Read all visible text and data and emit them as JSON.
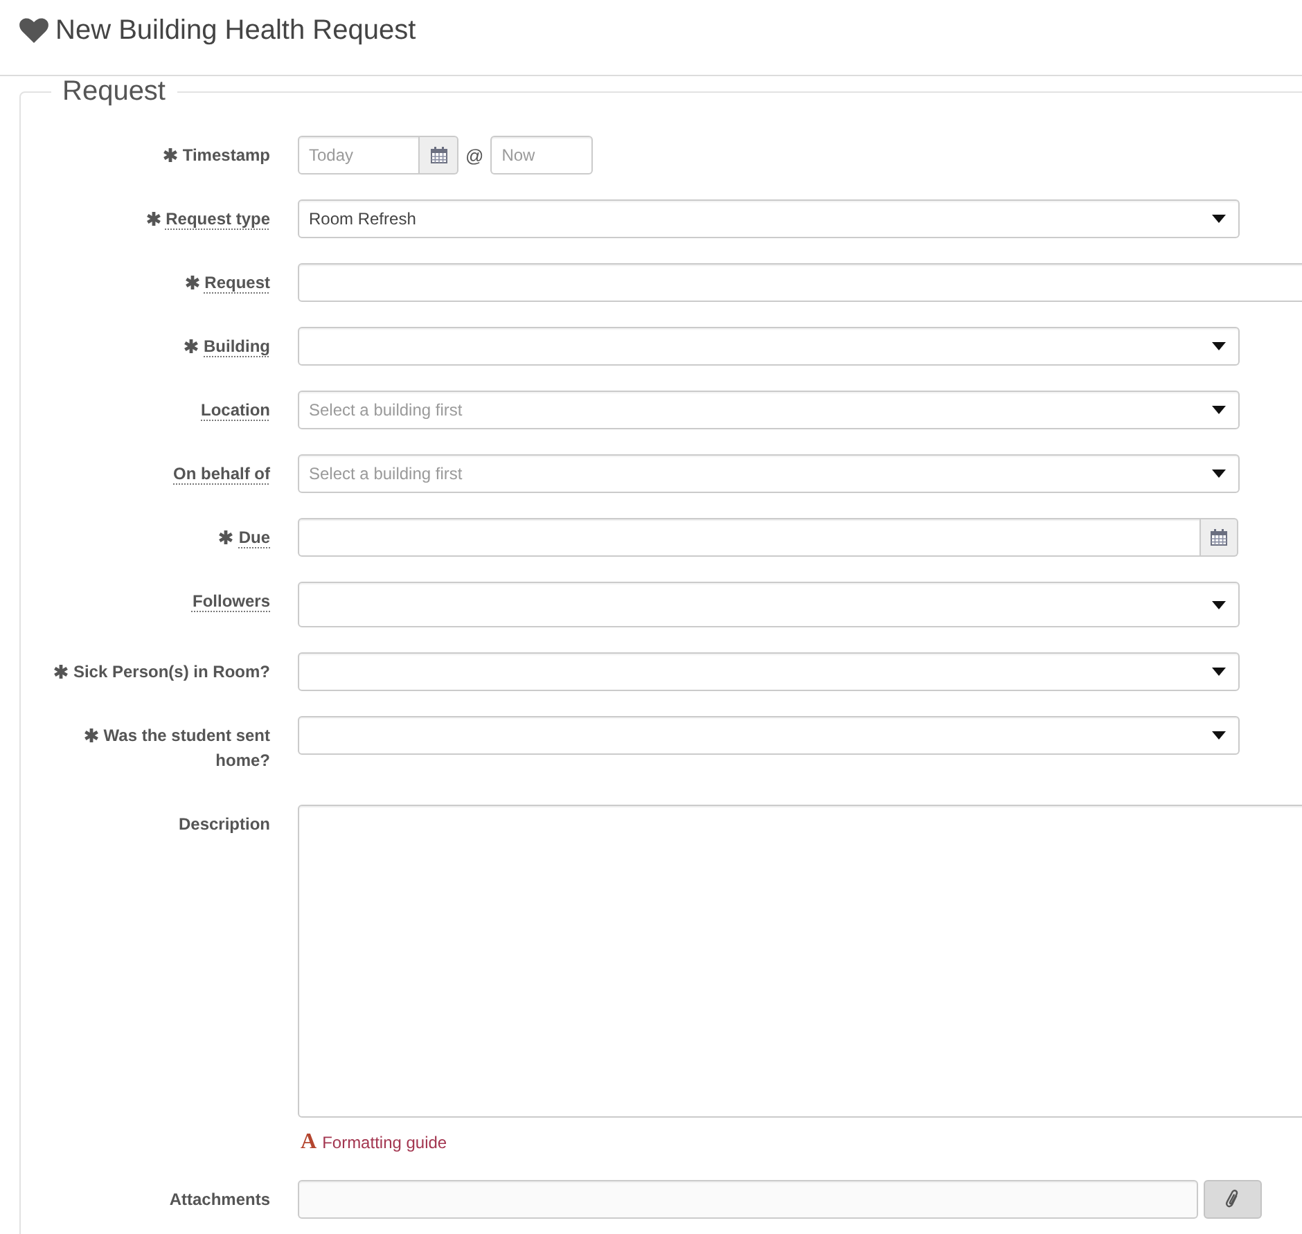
{
  "page": {
    "title": "New Building Health Request"
  },
  "fieldset": {
    "legend": "Request"
  },
  "fields": [
    {
      "kind": "datetime",
      "label": "Timestamp",
      "required": true,
      "tooltip": false,
      "date_placeholder": "Today",
      "separator": "@",
      "time_placeholder": "Now"
    },
    {
      "kind": "select",
      "label": "Request type",
      "required": true,
      "tooltip": true,
      "value": "Room Refresh"
    },
    {
      "kind": "text",
      "label": "Request",
      "required": true,
      "tooltip": true
    },
    {
      "kind": "select",
      "label": "Building",
      "required": true,
      "tooltip": true
    },
    {
      "kind": "select",
      "label": "Location",
      "required": false,
      "tooltip": true,
      "placeholder": "Select a building first"
    },
    {
      "kind": "select",
      "label": "On behalf of",
      "required": false,
      "tooltip": true,
      "placeholder": "Select a building first"
    },
    {
      "kind": "date",
      "label": "Due",
      "required": true,
      "tooltip": true
    },
    {
      "kind": "multiselect",
      "label": "Followers",
      "required": false,
      "tooltip": true
    },
    {
      "kind": "select",
      "label": "Sick Person(s) in Room?",
      "required": true,
      "tooltip": false
    },
    {
      "kind": "select",
      "label": "Was the student sent home?",
      "required": true,
      "tooltip": false
    },
    {
      "kind": "textarea",
      "label": "Description",
      "required": false,
      "tooltip": false,
      "link_icon": "A",
      "link": "Formatting guide"
    },
    {
      "kind": "file",
      "label": "Attachments",
      "required": false,
      "tooltip": false
    }
  ]
}
